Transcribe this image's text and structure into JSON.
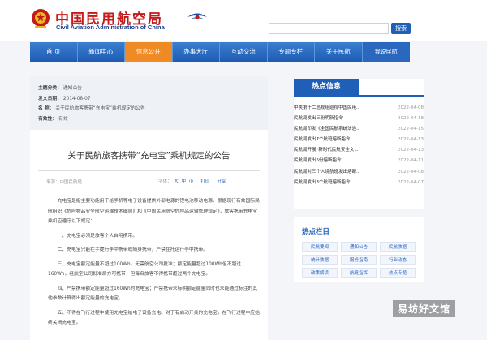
{
  "header": {
    "title_zh": "中国民用航空局",
    "title_en": "Civil Aviation Administration of China",
    "search_placeholder": "",
    "search_button": "搜索"
  },
  "nav": {
    "items": [
      {
        "label": "首 页"
      },
      {
        "label": "新闻中心"
      },
      {
        "label": "信息公开",
        "active": true
      },
      {
        "label": "办事大厅"
      },
      {
        "label": "互动交流"
      },
      {
        "label": "专题专栏"
      },
      {
        "label": "关于民航"
      },
      {
        "label": "我说民航"
      }
    ]
  },
  "meta": {
    "category_key": "主题分类：",
    "category_val": "通知公告",
    "date_key": "发文日期：",
    "date_val": "2014-08-07",
    "name_key": "名 称：",
    "name_val": "关于民航旅客携带“充电宝”乘机规定的公告",
    "validity_key": "有效性：",
    "validity_val": "有效"
  },
  "article": {
    "title": "关于民航旅客携带“充电宝”乘机规定的公告",
    "source": "来源：中国民航局",
    "font_label": "字体：",
    "font_big": "大",
    "font_mid": "中",
    "font_small": "小",
    "print": "打印",
    "share": "分享",
    "paragraphs": [
      "充电宝是指主要功能用于给手机等电子设备提供外部电源的锂电池移动电源。根据现行有效国际民航组织《危险物品安全航空运输技术细则》和《中国民用航空危险品运输管理规定》，旅客携带充电宝乘机应遵守以下规定：",
      "一、充电宝必须是旅客个人自用携带。",
      "二、充电宝只能在手提行李中携带或随身携带，严禁在托运行李中携带。",
      "三、充电宝额定能量不超过100Wh，无需航空公司批准；额定能量超过100Wh但不超过160Wh，经航空公司批准后方可携带，但每名旅客不得携带超过两个充电宝。",
      "四、严禁携带额定能量超过160Wh的充电宝；严禁携带未标明额定能量同时也未能通过标注的其他参数计算得出额定能量的充电宝。",
      "五、不得在飞行过程中使用充电宝给电子设备充电。对于有启动开关的充电宝，在飞行过程中应始终关闭充电宝。"
    ]
  },
  "hot": {
    "title": "热点信息",
    "items": [
      {
        "text": "中央第十二巡视组巡视中国民用...",
        "date": "2022-04-08"
      },
      {
        "text": "民航局发出三份明新指令",
        "date": "2022-04-18"
      },
      {
        "text": "民航局印发《全国民航系统法治...",
        "date": "2022-04-15"
      },
      {
        "text": "民航局发出7个航班熔断指令",
        "date": "2022-04-13"
      },
      {
        "text": "民航局开展“新时代民航安全文...",
        "date": "2022-04-13"
      },
      {
        "text": "民航局发出6份熔断指令",
        "date": "2022-04-11"
      },
      {
        "text": "民航局对三个入境航班发出熔断...",
        "date": "2022-04-08"
      },
      {
        "text": "民航局发出3个航班熔断指令",
        "date": "2022-04-07"
      }
    ]
  },
  "columns": {
    "title": "热点栏目",
    "items": [
      {
        "label": "民航要闻"
      },
      {
        "label": "通知公告"
      },
      {
        "label": "民航数据"
      },
      {
        "label": "统计数据"
      },
      {
        "label": "服务指南"
      },
      {
        "label": "行业动态"
      },
      {
        "label": "政策解读"
      },
      {
        "label": "航班指挥"
      },
      {
        "label": "热点专题"
      }
    ]
  },
  "watermark": {
    "text": "易坊好文馆"
  }
}
